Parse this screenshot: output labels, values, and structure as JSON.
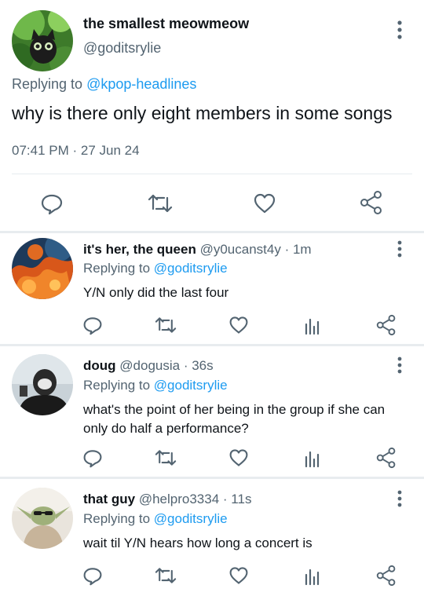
{
  "main_tweet": {
    "display_name": "the smallest meowmeow",
    "handle": "@goditsrylie",
    "replying_prefix": "Replying to ",
    "replying_to": "@kpop-headlines",
    "text": "why is there only eight members in some songs",
    "timestamp": "07:41 PM · 27 Jun 24",
    "actions": [
      "reply-icon",
      "retweet-icon",
      "like-icon",
      "share-icon"
    ]
  },
  "replies": [
    {
      "display_name": "it's her, the queen",
      "handle": "@y0ucanst4y",
      "meta": " · 1m",
      "replying_prefix": "Replying to ",
      "replying_to": "@goditsrylie",
      "text": "Y/N only did the last four"
    },
    {
      "display_name": "doug",
      "handle": "@dogusia",
      "meta": " · 36s",
      "replying_prefix": "Replying to ",
      "replying_to": "@goditsrylie",
      "text": "what's the point of her being in the group if she can only do half a performance?"
    },
    {
      "display_name": "that guy",
      "handle": "@helpro3334",
      "meta": " · 11s",
      "replying_prefix": "Replying to ",
      "replying_to": "@goditsrylie",
      "text": "wait til Y/N hears how long a concert is"
    }
  ],
  "colors": {
    "link": "#1d9bf0",
    "secondary_text": "#536471",
    "icon": "#536471",
    "separator": "#e8ecef"
  }
}
